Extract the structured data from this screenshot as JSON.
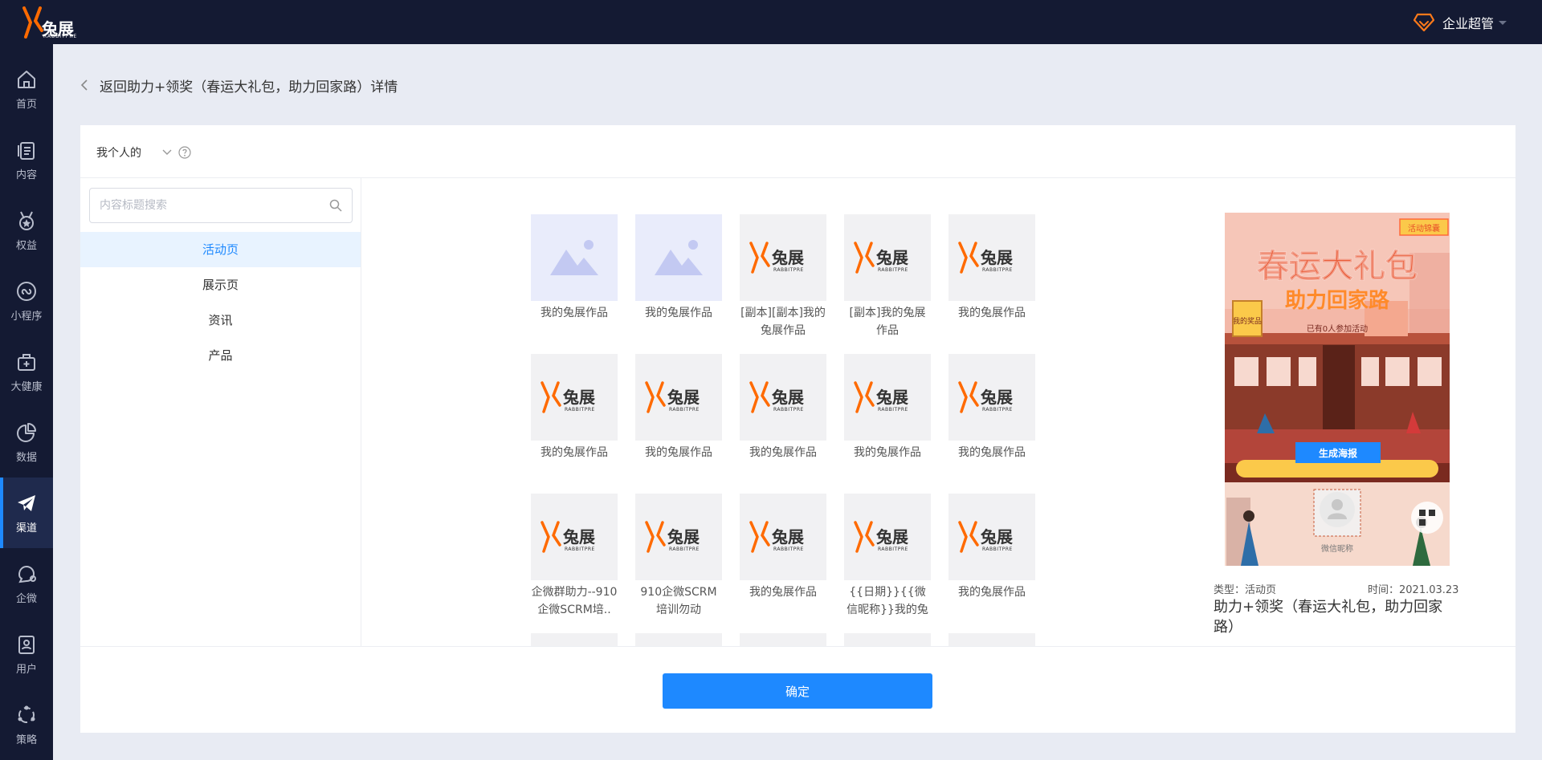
{
  "brand": {
    "name": "兔展",
    "sub": "RABBITPRE",
    "accent": "#ff6a00"
  },
  "topbar": {
    "user_label": "企业超管"
  },
  "sidebar": {
    "items": [
      {
        "label": "首页",
        "icon": "home-icon"
      },
      {
        "label": "内容",
        "icon": "document-icon"
      },
      {
        "label": "权益",
        "icon": "medal-icon"
      },
      {
        "label": "小程序",
        "icon": "mini-program-icon"
      },
      {
        "label": "大健康",
        "icon": "health-kit-icon"
      },
      {
        "label": "数据",
        "icon": "pie-chart-icon"
      },
      {
        "label": "渠道",
        "icon": "paper-plane-icon",
        "active": true
      },
      {
        "label": "企微",
        "icon": "chat-icon"
      },
      {
        "label": "用户",
        "icon": "user-card-icon"
      },
      {
        "label": "策略",
        "icon": "strategy-icon"
      }
    ]
  },
  "breadcrumb": {
    "text": "返回助力+领奖（春运大礼包，助力回家路）详情"
  },
  "filter": {
    "scope": "我个人的"
  },
  "search": {
    "placeholder": "内容标题搜索"
  },
  "categories": [
    {
      "label": "活动页",
      "active": true
    },
    {
      "label": "展示页"
    },
    {
      "label": "资讯"
    },
    {
      "label": "产品"
    }
  ],
  "works": [
    {
      "title": "我的兔展作品",
      "thumb": "placeholder"
    },
    {
      "title": "我的兔展作品",
      "thumb": "placeholder"
    },
    {
      "title": "[副本][副本]我的兔展作品",
      "thumb": "logo"
    },
    {
      "title": "[副本]我的兔展作品",
      "thumb": "logo"
    },
    {
      "title": "我的兔展作品",
      "thumb": "logo"
    },
    {
      "title": "我的兔展作品",
      "thumb": "logo"
    },
    {
      "title": "我的兔展作品",
      "thumb": "logo"
    },
    {
      "title": "我的兔展作品",
      "thumb": "logo"
    },
    {
      "title": "我的兔展作品",
      "thumb": "logo"
    },
    {
      "title": "我的兔展作品",
      "thumb": "logo"
    },
    {
      "title": "企微群助力--910企微SCRM培..",
      "thumb": "logo"
    },
    {
      "title": "910企微SCRM培训勿动",
      "thumb": "logo"
    },
    {
      "title": "我的兔展作品",
      "thumb": "logo"
    },
    {
      "title": "{{日期}}{{微信昵称}}我的兔展...",
      "thumb": "logo"
    },
    {
      "title": "我的兔展作品",
      "thumb": "logo"
    },
    {
      "title": "",
      "thumb": "logo"
    },
    {
      "title": "",
      "thumb": "logo"
    },
    {
      "title": "",
      "thumb": "logo"
    },
    {
      "title": "",
      "thumb": "logo"
    },
    {
      "title": "",
      "thumb": "logo"
    }
  ],
  "preview": {
    "poster_title": "春运大礼包",
    "poster_subtitle": "助力回家路",
    "badge": "活动锦囊",
    "participants": "已有0人参加活动",
    "prize": "我的奖品",
    "generate_button": "生成海报",
    "nickname": "微信昵称",
    "type": "类型：活动页",
    "time": "时间：2021.03.23",
    "title": "助力+领奖（春运大礼包，助力回家路）"
  },
  "footer": {
    "confirm_label": "确定"
  }
}
